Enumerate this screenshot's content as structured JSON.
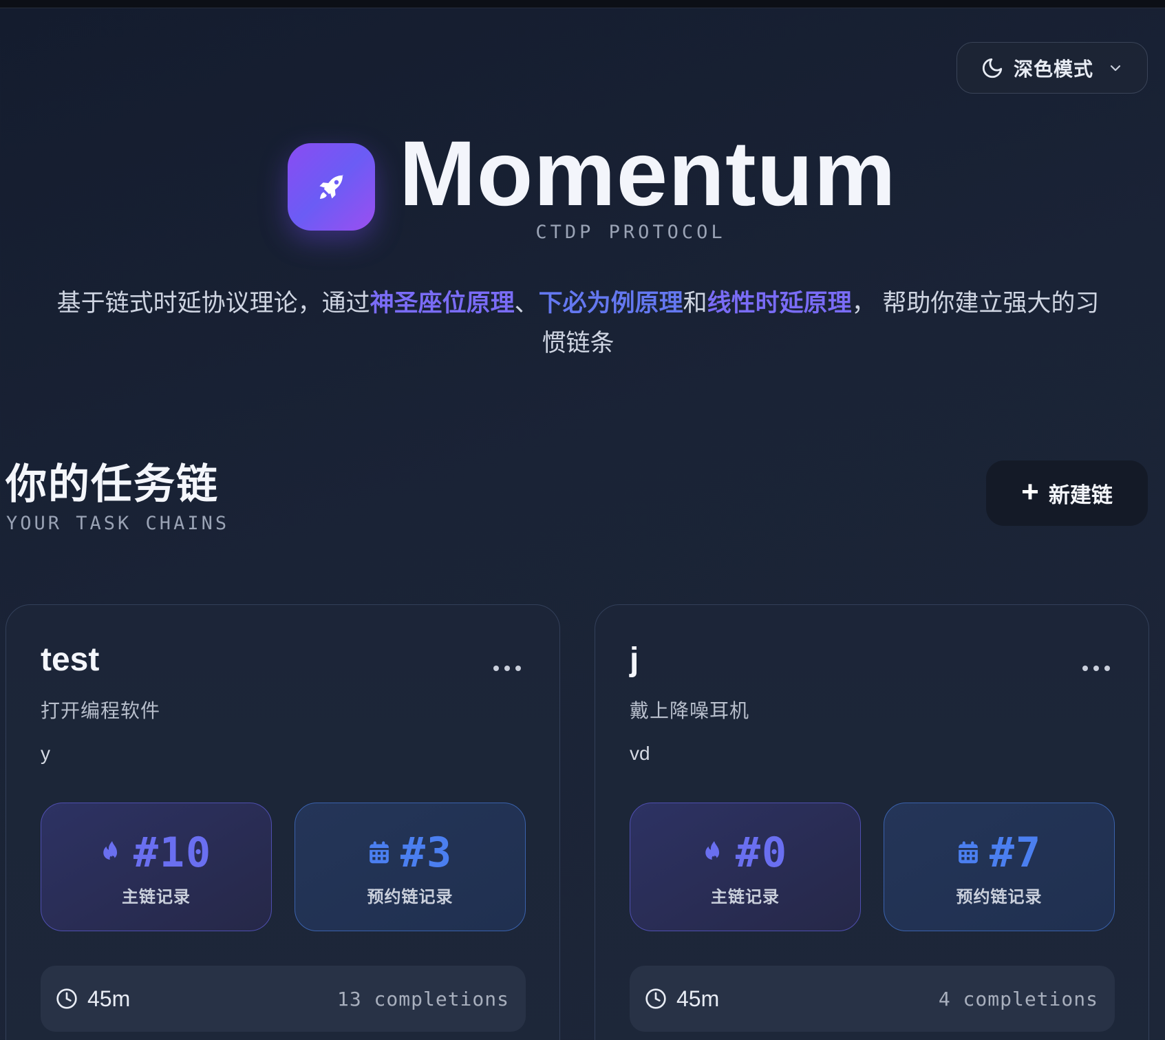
{
  "header": {
    "theme_toggle_label": "深色模式"
  },
  "hero": {
    "title": "Momentum",
    "subtitle": "CTDP PROTOCOL",
    "intro": {
      "part1": "基于链式时延协议理论，通过",
      "link1": "神圣座位原理",
      "sep1": "、",
      "link2": "下必为例原理",
      "sep2": "和",
      "link3": "线性时延原理",
      "part2": "， 帮助你建立强大的习惯链条"
    }
  },
  "chains_section": {
    "title": "你的任务链",
    "subtitle": "YOUR TASK CHAINS",
    "new_button_label": "新建链"
  },
  "chains": [
    {
      "name": "test",
      "trigger": "打开编程软件",
      "description": "y",
      "main_record": "#10",
      "main_label": "主链记录",
      "sched_record": "#3",
      "sched_label": "预约链记录",
      "duration": "45m",
      "completions": "13 completions"
    },
    {
      "name": "j",
      "trigger": "戴上降噪耳机",
      "description": "vd",
      "main_record": "#0",
      "main_label": "主链记录",
      "sched_record": "#7",
      "sched_label": "预约链记录",
      "duration": "45m",
      "completions": "4 completions"
    }
  ],
  "colors": {
    "accent_purple": "#7a6cf6",
    "accent_blue": "#4b7ff0",
    "background": "#1a2336"
  }
}
